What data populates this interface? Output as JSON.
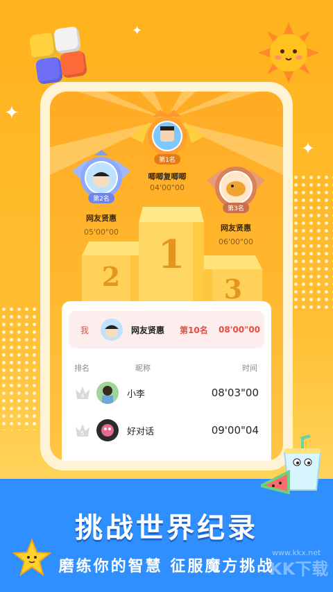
{
  "leaderboard": {
    "first": {
      "tag": "第1名",
      "name": "唧唧复唧唧",
      "time": "04'00\"00"
    },
    "second": {
      "tag": "第2名",
      "name": "网友贤惠",
      "time": "05'00\"00"
    },
    "third": {
      "tag": "第3名",
      "name": "网友贤惠",
      "time": "06'00\"00"
    },
    "podium_numbers": [
      "1",
      "2",
      "3"
    ]
  },
  "my_rank": {
    "label": "我",
    "nickname": "网友贤惠",
    "rank": "第10名",
    "time": "08'00\"00"
  },
  "columns": {
    "rank": "排名",
    "nickname": "昵称",
    "time": "时间"
  },
  "rows": [
    {
      "rank": "4",
      "nickname": "小李",
      "time": "08'03\"00"
    },
    {
      "rank": "5",
      "nickname": "好对话",
      "time": "09'00\"04"
    }
  ],
  "promo": {
    "title": "挑战世界纪录",
    "subtitle": "磨练你的智慧 征服魔方挑战"
  },
  "watermark": {
    "small": "www.kkx.net",
    "big": "KK下载"
  },
  "colors": {
    "accent": "#ffb21c",
    "banner": "#2f8fff",
    "rank_red": "#e84b3f"
  }
}
